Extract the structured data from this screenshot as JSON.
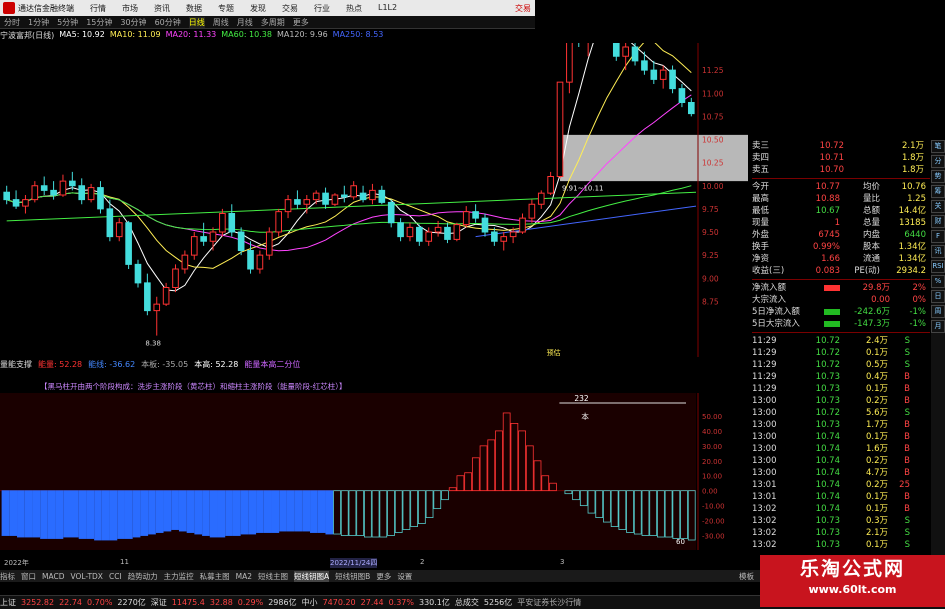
{
  "app": {
    "title": "通达信金融终端",
    "trade_label": "交易",
    "menu": [
      "行情",
      "市场",
      "资讯",
      "数据",
      "专题",
      "发现",
      "交易",
      "行业",
      "热点",
      "L1L2"
    ]
  },
  "period_tabs": {
    "items": [
      "分时",
      "1分钟",
      "5分钟",
      "15分钟",
      "30分钟",
      "60分钟",
      "日线",
      "周线",
      "月线",
      "多周期",
      "更多"
    ],
    "active": "日线"
  },
  "ma_legend": {
    "stock": "宁波富邦(日线)",
    "items": [
      {
        "label": "MA5: 10.92",
        "color": "#ffffff"
      },
      {
        "label": "MA10: 11.09",
        "color": "#ffee55"
      },
      {
        "label": "MA20: 11.33",
        "color": "#ff44ff"
      },
      {
        "label": "MA60: 10.38",
        "color": "#44ee44"
      },
      {
        "label": "MA120: 9.96",
        "color": "#bbbbbb"
      },
      {
        "label": "MA250: 8.53",
        "color": "#4466ff"
      }
    ]
  },
  "chart_data": {
    "type": "candlestick",
    "symbol": "宁波富邦",
    "period": "日线",
    "price_ticks": [
      "11.25",
      "11.00",
      "10.75",
      "10.50",
      "10.25",
      "10.00",
      "9.75",
      "9.50",
      "9.25",
      "9.00",
      "8.75"
    ],
    "ylim": [
      8.3,
      11.5
    ],
    "ohlc": [
      [
        9.93,
        10.0,
        9.8,
        9.85
      ],
      [
        9.85,
        9.95,
        9.75,
        9.78
      ],
      [
        9.78,
        9.9,
        9.7,
        9.85
      ],
      [
        9.85,
        10.05,
        9.82,
        10.0
      ],
      [
        10.0,
        10.1,
        9.9,
        9.95
      ],
      [
        9.95,
        10.05,
        9.85,
        9.9
      ],
      [
        9.9,
        10.12,
        9.88,
        10.05
      ],
      [
        10.05,
        10.15,
        9.95,
        10.0
      ],
      [
        10.0,
        10.08,
        9.8,
        9.85
      ],
      [
        9.85,
        10.02,
        9.82,
        9.98
      ],
      [
        9.98,
        10.05,
        9.7,
        9.75
      ],
      [
        9.75,
        9.85,
        9.4,
        9.45
      ],
      [
        9.45,
        9.65,
        9.4,
        9.6
      ],
      [
        9.6,
        9.62,
        9.1,
        9.15
      ],
      [
        9.15,
        9.2,
        8.9,
        8.95
      ],
      [
        8.95,
        9.05,
        8.6,
        8.65
      ],
      [
        8.65,
        8.8,
        8.38,
        8.72
      ],
      [
        8.72,
        8.95,
        8.7,
        8.9
      ],
      [
        8.9,
        9.15,
        8.85,
        9.1
      ],
      [
        9.1,
        9.3,
        9.05,
        9.25
      ],
      [
        9.25,
        9.5,
        9.2,
        9.45
      ],
      [
        9.45,
        9.6,
        9.35,
        9.4
      ],
      [
        9.4,
        9.55,
        9.3,
        9.5
      ],
      [
        9.5,
        9.75,
        9.45,
        9.7
      ],
      [
        9.7,
        9.8,
        9.45,
        9.5
      ],
      [
        9.5,
        9.55,
        9.25,
        9.3
      ],
      [
        9.3,
        9.4,
        9.05,
        9.1
      ],
      [
        9.1,
        9.3,
        9.05,
        9.25
      ],
      [
        9.25,
        9.55,
        9.2,
        9.5
      ],
      [
        9.5,
        9.75,
        9.45,
        9.72
      ],
      [
        9.72,
        9.9,
        9.65,
        9.85
      ],
      [
        9.85,
        9.95,
        9.75,
        9.8
      ],
      [
        9.8,
        9.9,
        9.7,
        9.85
      ],
      [
        9.85,
        9.95,
        9.8,
        9.92
      ],
      [
        9.92,
        9.98,
        9.75,
        9.8
      ],
      [
        9.8,
        9.92,
        9.78,
        9.9
      ],
      [
        9.9,
        10.0,
        9.82,
        9.88
      ],
      [
        9.88,
        10.05,
        9.85,
        10.0
      ],
      [
        9.92,
        10.0,
        9.82,
        9.85
      ],
      [
        9.85,
        10.02,
        9.8,
        9.95
      ],
      [
        9.95,
        10.0,
        9.8,
        9.82
      ],
      [
        9.82,
        9.85,
        9.55,
        9.6
      ],
      [
        9.6,
        9.65,
        9.4,
        9.45
      ],
      [
        9.45,
        9.6,
        9.4,
        9.55
      ],
      [
        9.55,
        9.58,
        9.35,
        9.4
      ],
      [
        9.4,
        9.55,
        9.35,
        9.5
      ],
      [
        9.5,
        9.62,
        9.45,
        9.55
      ],
      [
        9.55,
        9.6,
        9.38,
        9.42
      ],
      [
        9.42,
        9.6,
        9.4,
        9.58
      ],
      [
        9.58,
        9.78,
        9.55,
        9.72
      ],
      [
        9.72,
        9.8,
        9.6,
        9.65
      ],
      [
        9.65,
        9.7,
        9.45,
        9.5
      ],
      [
        9.5,
        9.55,
        9.35,
        9.4
      ],
      [
        9.4,
        9.5,
        9.3,
        9.45
      ],
      [
        9.45,
        9.55,
        9.38,
        9.5
      ],
      [
        9.5,
        9.7,
        9.48,
        9.65
      ],
      [
        9.65,
        9.85,
        9.6,
        9.8
      ],
      [
        9.8,
        9.95,
        9.75,
        9.92
      ],
      [
        9.92,
        10.15,
        9.9,
        10.1
      ],
      [
        10.1,
        11.12,
        10.08,
        11.12
      ],
      [
        11.12,
        12.23,
        11.0,
        12.23
      ],
      [
        12.23,
        12.3,
        11.5,
        11.6
      ],
      [
        11.6,
        11.9,
        11.4,
        11.8
      ],
      [
        11.8,
        11.95,
        11.6,
        11.7
      ],
      [
        11.7,
        11.85,
        11.55,
        11.6
      ],
      [
        11.6,
        11.75,
        11.35,
        11.4
      ],
      [
        11.4,
        11.55,
        11.25,
        11.5
      ],
      [
        11.5,
        11.6,
        11.3,
        11.35
      ],
      [
        11.35,
        11.45,
        11.2,
        11.25
      ],
      [
        11.25,
        11.35,
        11.1,
        11.15
      ],
      [
        11.15,
        11.3,
        11.05,
        11.25
      ],
      [
        11.25,
        11.3,
        11.0,
        11.05
      ],
      [
        11.05,
        11.1,
        10.85,
        10.9
      ],
      [
        10.9,
        10.95,
        10.75,
        10.78
      ]
    ],
    "annotations": {
      "low_label": "8.38",
      "shaded_range_label": "9.91~10.11",
      "event_label": "预估"
    },
    "indicator": {
      "name": "量能支撑",
      "legend_items": [
        {
          "label": "能量: 52.28",
          "color": "#ff3333"
        },
        {
          "label": "能线: -36.62",
          "color": "#4488ff"
        },
        {
          "label": "本板: -35.05",
          "color": "#aaaaaa"
        },
        {
          "label": "本高: 52.28",
          "color": "#ffffff"
        },
        {
          "label": "能量本高二分位",
          "color": "#cc66ff"
        }
      ],
      "description": "【黑马柱开由两个阶段构成：洗步主涨阶段（黄芯柱）和缩柱主涨阶段（能量阶段-红芯柱）】",
      "ylim": [
        -35,
        60
      ],
      "y_ticks": [
        "50.00",
        "40.00",
        "30.00",
        "20.00",
        "10.00",
        "0.00",
        "-10.00",
        "-20.00",
        "-30.00"
      ],
      "peak_label": "232",
      "top_marker": "本",
      "low_label": "60",
      "values": [
        -30,
        -30,
        -31,
        -31,
        -31,
        -32,
        -32,
        -32,
        -31,
        -31,
        -32,
        -32,
        -33,
        -33,
        -33,
        -32,
        -32,
        -31,
        -30,
        -29,
        -28,
        -27,
        -26,
        -27,
        -28,
        -29,
        -30,
        -31,
        -31,
        -30,
        -30,
        -29,
        -29,
        -28,
        -28,
        -28,
        -27,
        -27,
        -27,
        -27,
        -28,
        -28,
        -29,
        -29,
        -30,
        -30,
        -30,
        -31,
        -31,
        -31,
        -30,
        -28,
        -26,
        -24,
        -22,
        -18,
        -12,
        -6,
        2,
        10,
        12,
        22,
        30,
        34,
        40,
        52,
        45,
        40,
        30,
        20,
        10,
        5,
        0,
        -2,
        -6,
        -10,
        -15,
        -18,
        -21,
        -24,
        -26,
        -28,
        -29,
        -30,
        -30,
        -31,
        -31,
        -32,
        -32,
        -33
      ]
    }
  },
  "quote": {
    "rows": [
      {
        "l": "卖三",
        "p": "10.72",
        "v": "2.1万"
      },
      {
        "l": "卖四",
        "p": "10.71",
        "v": "1.8万"
      },
      {
        "l": "卖五",
        "p": "10.70",
        "v": "1.8万"
      }
    ],
    "stats": [
      {
        "a": "今开",
        "b": "10.77",
        "c": "均价",
        "d": "10.76"
      },
      {
        "a": "最高",
        "b": "10.88",
        "c": "量比",
        "d": "1.25"
      },
      {
        "a": "最低",
        "b": "10.67",
        "c": "总额",
        "d": "14.4亿"
      },
      {
        "a": "现量",
        "b": "1",
        "c": "总量",
        "d": "13185"
      },
      {
        "a": "外盘",
        "b": "6745",
        "c": "内盘",
        "d": "6440"
      },
      {
        "a": "换手",
        "b": "0.99%",
        "c": "股本",
        "d": "1.34亿"
      },
      {
        "a": "净资",
        "b": "1.66",
        "c": "流通",
        "d": "1.34亿"
      },
      {
        "a": "收益(三)",
        "b": "0.083",
        "c": "PE(动)",
        "d": "2934.2"
      }
    ],
    "flows": [
      {
        "a": "净流入额",
        "b": "29.8万",
        "c": "2%"
      },
      {
        "a": "大宗流入",
        "b": "0.00",
        "c": "0%"
      },
      {
        "a": "5日净流入额",
        "b": "-242.6万",
        "c": "-1%"
      },
      {
        "a": "5日大宗流入",
        "b": "-147.3万",
        "c": "-1%"
      }
    ],
    "ticks": [
      {
        "t": "11:29",
        "p": "10.72",
        "v": "2.4万",
        "f": "S"
      },
      {
        "t": "11:29",
        "p": "10.72",
        "v": "0.1万",
        "f": "S"
      },
      {
        "t": "11:29",
        "p": "10.72",
        "v": "0.5万",
        "f": "S"
      },
      {
        "t": "11:29",
        "p": "10.73",
        "v": "0.4万",
        "f": "B"
      },
      {
        "t": "11:29",
        "p": "10.73",
        "v": "0.1万",
        "f": "B"
      },
      {
        "t": "13:00",
        "p": "10.73",
        "v": "0.2万",
        "f": "B"
      },
      {
        "t": "13:00",
        "p": "10.72",
        "v": "5.6万",
        "f": "S"
      },
      {
        "t": "13:00",
        "p": "10.73",
        "v": "1.7万",
        "f": "B"
      },
      {
        "t": "13:00",
        "p": "10.74",
        "v": "0.1万",
        "f": "B"
      },
      {
        "t": "13:00",
        "p": "10.74",
        "v": "1.6万",
        "f": "B"
      },
      {
        "t": "13:00",
        "p": "10.74",
        "v": "0.2万",
        "f": "B"
      },
      {
        "t": "13:00",
        "p": "10.74",
        "v": "4.7万",
        "f": "B"
      },
      {
        "t": "13:01",
        "p": "10.74",
        "v": "0.2万",
        "f": "25"
      },
      {
        "t": "13:01",
        "p": "10.74",
        "v": "0.1万",
        "f": "B"
      },
      {
        "t": "13:02",
        "p": "10.74",
        "v": "0.1万",
        "f": "B"
      },
      {
        "t": "13:02",
        "p": "10.73",
        "v": "0.3万",
        "f": "S"
      },
      {
        "t": "13:02",
        "p": "10.73",
        "v": "2.1万",
        "f": "S"
      },
      {
        "t": "13:02",
        "p": "10.73",
        "v": "0.1万",
        "f": "S"
      }
    ]
  },
  "side_tabs": [
    "笔",
    "分",
    "势",
    "筹",
    "关",
    "财",
    "F",
    "讯",
    "RSI",
    "%",
    "日",
    "周",
    "月"
  ],
  "date_labels": [
    "2022年",
    "11",
    "2022/11/24四",
    "2",
    "3"
  ],
  "ind_tabs": {
    "items": [
      "指标",
      "窗口",
      "MACD",
      "VOL-TDX",
      "CCI",
      "趋势动力",
      "主力监控",
      "私募主图",
      "MA2",
      "短线主图",
      "短线钥图A",
      "短线钥图B",
      "更多",
      "设置"
    ],
    "active": "短线钥图A",
    "right": "模板"
  },
  "status": {
    "items": [
      {
        "t": "上证",
        "c": "#dddddd"
      },
      {
        "t": "3252.82",
        "c": "#ff4444"
      },
      {
        "t": "22.74",
        "c": "#ff4444"
      },
      {
        "t": "0.70%",
        "c": "#ff4444"
      },
      {
        "t": "2270亿",
        "c": "#dddddd"
      },
      {
        "t": "深证",
        "c": "#dddddd"
      },
      {
        "t": "11475.4",
        "c": "#ff4444"
      },
      {
        "t": "32.88",
        "c": "#ff4444"
      },
      {
        "t": "0.29%",
        "c": "#ff4444"
      },
      {
        "t": "2986亿",
        "c": "#dddddd"
      },
      {
        "t": "中小",
        "c": "#dddddd"
      },
      {
        "t": "7470.20",
        "c": "#ff4444"
      },
      {
        "t": "27.44",
        "c": "#ff4444"
      },
      {
        "t": "0.37%",
        "c": "#ff4444"
      },
      {
        "t": "330.1亿",
        "c": "#dddddd"
      },
      {
        "t": "总成交",
        "c": "#dddddd"
      },
      {
        "t": "5256亿",
        "c": "#dddddd"
      },
      {
        "t": "平安证券长沙行情",
        "c": "#aaaaaa"
      }
    ]
  },
  "watermark": {
    "line1": "乐淘公式网",
    "line2": "www.60lt.com"
  }
}
